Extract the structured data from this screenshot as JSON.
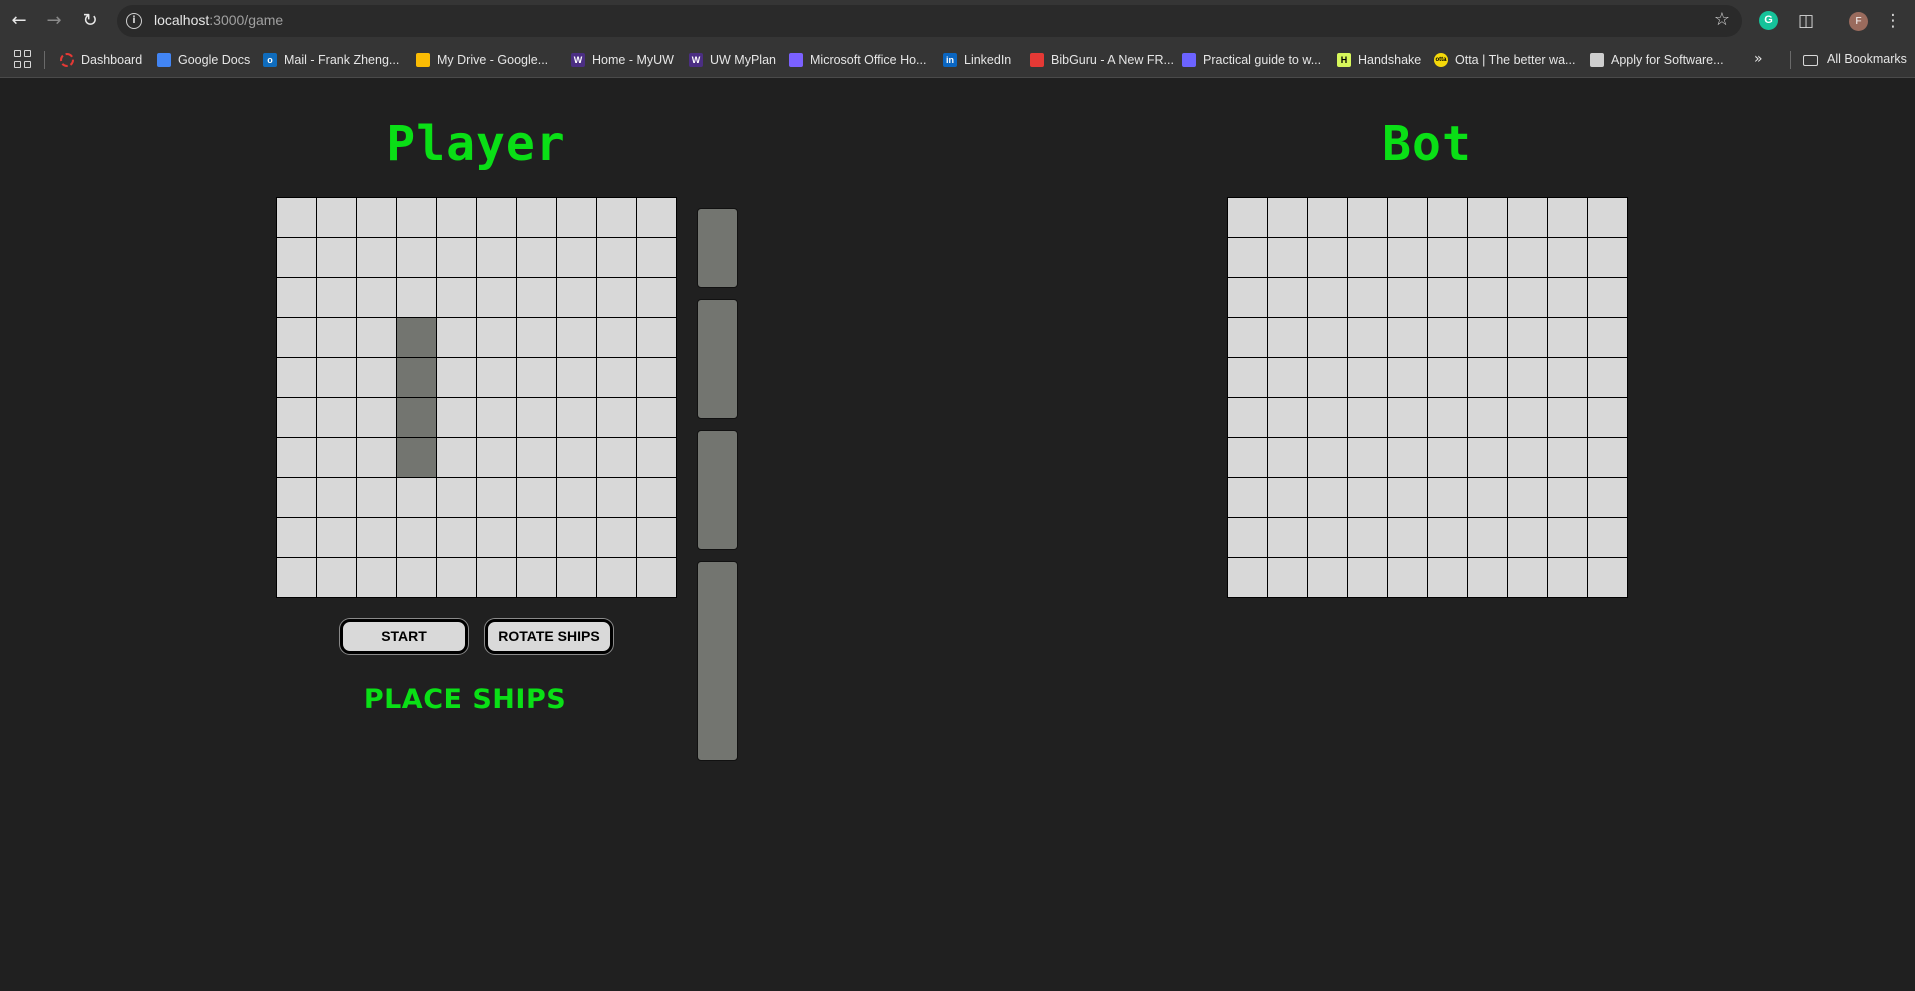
{
  "browser": {
    "url_host": "localhost",
    "url_path": ":3000/game",
    "avatar_letter": "F",
    "grammarly_letter": "G",
    "bookmarks": [
      {
        "label": "Dashboard",
        "color": "#e53935",
        "icon": "dashboard-icon"
      },
      {
        "label": "Google Docs",
        "color": "#4285f4",
        "icon": "google-docs-icon"
      },
      {
        "label": "Mail - Frank Zheng...",
        "color": "#0f6cbd",
        "icon": "outlook-icon"
      },
      {
        "label": "My Drive - Google...",
        "color": "#fbbc04",
        "icon": "google-drive-icon"
      },
      {
        "label": "Home - MyUW",
        "color": "#4b2e83",
        "icon": "uw-icon"
      },
      {
        "label": "UW MyPlan",
        "color": "#4b2e83",
        "icon": "uw-icon"
      },
      {
        "label": "Microsoft Office Ho...",
        "color": "#7b61ff",
        "icon": "office-icon"
      },
      {
        "label": "LinkedIn",
        "color": "#0a66c2",
        "icon": "linkedin-icon"
      },
      {
        "label": "BibGuru - A New FR...",
        "color": "#e53935",
        "icon": "bibguru-icon"
      },
      {
        "label": "Practical guide to w...",
        "color": "#6c63ff",
        "icon": "code-icon"
      },
      {
        "label": "Handshake",
        "color": "#d7f75b",
        "icon": "handshake-icon"
      },
      {
        "label": "Otta | The better wa...",
        "color": "#f5d90a",
        "icon": "otta-icon"
      },
      {
        "label": "Apply for Software...",
        "color": "#cfcfcf",
        "icon": "roblox-icon"
      }
    ],
    "all_bookmarks": "All Bookmarks",
    "fav_letters": [
      "",
      "",
      "o",
      "",
      "W",
      "W",
      "",
      "in",
      "",
      "</>",
      "H",
      "otta",
      ""
    ]
  },
  "game": {
    "player_title": "Player",
    "bot_title": "Bot",
    "start_label": "START",
    "rotate_label": "ROTATE SHIPS",
    "status_text": "PLACE SHIPS",
    "grid_size": 10,
    "placed_ship": {
      "column": 4,
      "rows": [
        4,
        5,
        6,
        7
      ],
      "orientation": "vertical"
    },
    "colors": {
      "accent": "#0adf16",
      "cell": "#d8d8d8",
      "ship": "#737570",
      "background": "#202020"
    },
    "dock_ships": [
      {
        "name": "ship-2",
        "length": 2
      },
      {
        "name": "ship-3a",
        "length": 3
      },
      {
        "name": "ship-3b",
        "length": 3
      },
      {
        "name": "ship-5",
        "length": 5
      }
    ]
  }
}
